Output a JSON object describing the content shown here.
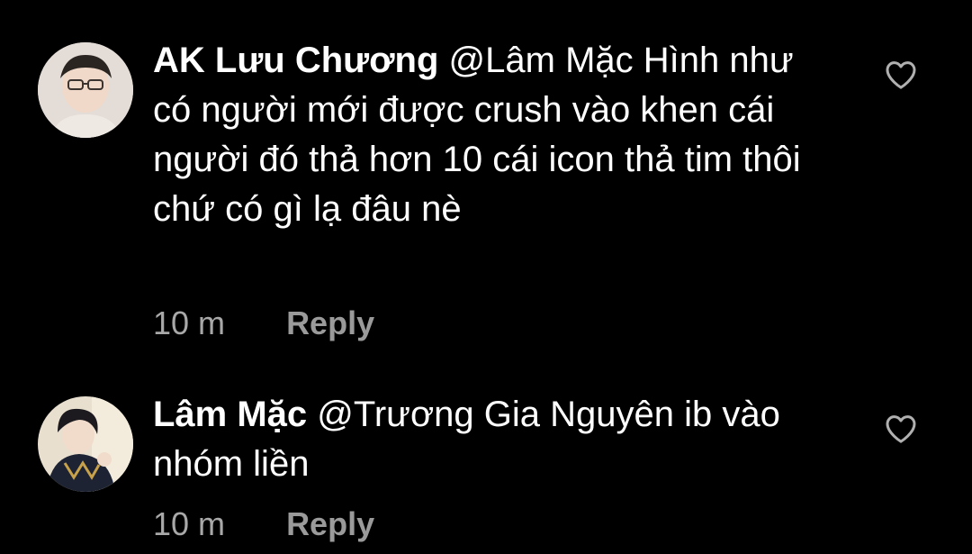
{
  "colors": {
    "background": "#000000",
    "text": "#ffffff",
    "muted": "#a8a8a8"
  },
  "comments": [
    {
      "username": "AK Lưu Chương",
      "text": "@Lâm Mặc Hình như có người mới được crush vào khen cái người đó thả hơn 10 cái icon thả tim thôi chứ có gì lạ đâu nè",
      "time": "10 m",
      "reply_label": "Reply",
      "like_icon": "heart-outline-icon",
      "avatar": "user-avatar"
    },
    {
      "username": "Lâm Mặc",
      "text": "@Trương Gia Nguyên ib vào nhóm liền",
      "time": "10 m",
      "reply_label": "Reply",
      "like_icon": "heart-outline-icon",
      "avatar": "user-avatar"
    }
  ]
}
